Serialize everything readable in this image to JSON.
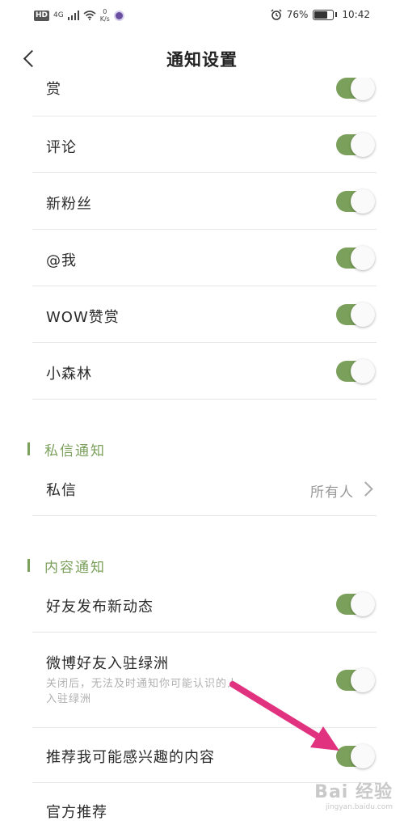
{
  "status_bar": {
    "hd": "HD",
    "network": "4G",
    "speed_value": "0",
    "speed_unit": "K/s",
    "battery": "76%",
    "battery_level": 0.76,
    "time": "10:42"
  },
  "nav": {
    "title": "通知设置"
  },
  "rows": [
    {
      "label": "赏",
      "on": true
    },
    {
      "label": "评论",
      "on": true
    },
    {
      "label": "新粉丝",
      "on": true
    },
    {
      "label": "@我",
      "on": true
    },
    {
      "label": "WOW赞赏",
      "on": true
    },
    {
      "label": "小森林",
      "on": true
    }
  ],
  "dm_section": {
    "header": "私信通知",
    "row": {
      "label": "私信",
      "value": "所有人"
    }
  },
  "content_section": {
    "header": "内容通知",
    "rows": [
      {
        "label": "好友发布新动态",
        "on": true
      },
      {
        "label": "微博好友入驻绿洲",
        "sub_line1": "关闭后，无法及时通知你可能认识的人",
        "sub_line2": "入驻绿洲",
        "on": true
      },
      {
        "label": "推荐我可能感兴趣的内容",
        "on": true
      },
      {
        "label": "官方推荐"
      }
    ]
  },
  "watermark": {
    "main": "Bai 经验",
    "sub": "jingyan.baidu.com"
  },
  "colors": {
    "accent": "#7ba05b",
    "arrow": "#e0327f"
  }
}
